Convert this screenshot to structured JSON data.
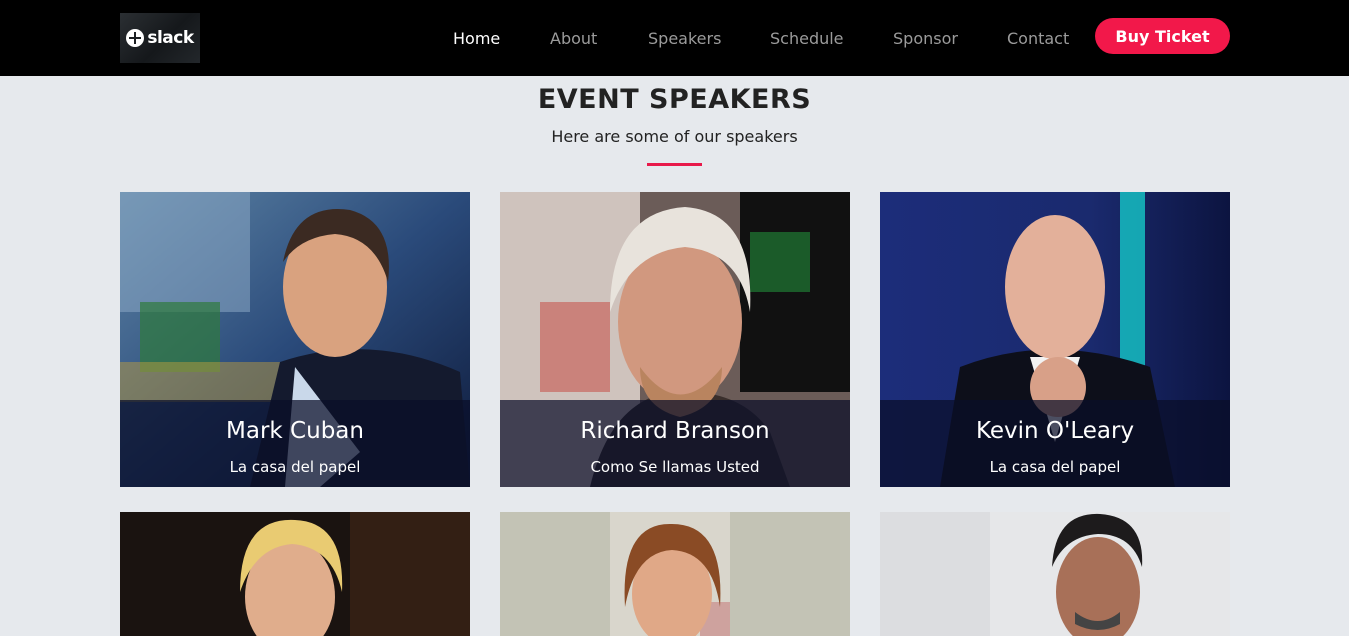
{
  "brand": {
    "logo_text": "slack"
  },
  "nav": {
    "items": [
      {
        "label": "Home",
        "active": true
      },
      {
        "label": "About",
        "active": false
      },
      {
        "label": "Speakers",
        "active": false
      },
      {
        "label": "Schedule",
        "active": false
      },
      {
        "label": "Sponsor",
        "active": false
      },
      {
        "label": "Contact",
        "active": false
      }
    ],
    "cta_label": "Buy Ticket"
  },
  "section": {
    "title": "EVENT SPEAKERS",
    "subtitle": "Here are some of our speakers"
  },
  "speakers": [
    {
      "name": "Mark Cuban",
      "role": "La casa del papel"
    },
    {
      "name": "Richard Branson",
      "role": "Como Se llamas Usted"
    },
    {
      "name": "Kevin O'Leary",
      "role": "La casa del papel"
    },
    {
      "name": "",
      "role": ""
    },
    {
      "name": "",
      "role": ""
    },
    {
      "name": "",
      "role": ""
    }
  ],
  "colors": {
    "navbar_bg": "#000000",
    "accent": "#f2184a",
    "page_bg": "#e6e9ed",
    "nav_active": "#ffffff",
    "nav_inactive": "#9b9b9b"
  }
}
